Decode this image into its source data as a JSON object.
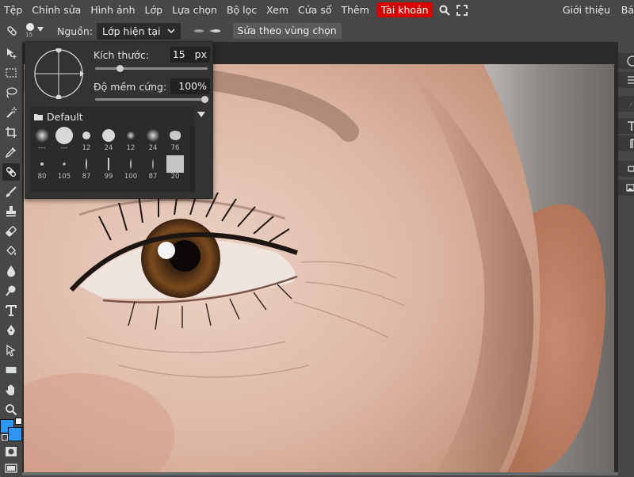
{
  "menu": {
    "items": [
      "Tệp",
      "Chỉnh sửa",
      "Hình ảnh",
      "Lớp",
      "Lựa chọn",
      "Bộ lọc",
      "Xem",
      "Cửa sổ",
      "Thêm"
    ],
    "account": "Tài khoản",
    "about": "Giới thiệu",
    "cut_item": "Bá"
  },
  "options": {
    "brush_size_small": "15",
    "source_label": "Nguồn:",
    "source_value": "Lớp hiện tại",
    "fix_button": "Sửa theo vùng chọn"
  },
  "brush_panel": {
    "size_label": "Kích thước:",
    "size_value": "15",
    "size_unit": "px",
    "size_fraction": 0.14,
    "hardness_label": "Độ mềm cứng:",
    "hardness_value": "100%",
    "hardness_fraction": 1.0,
    "preset_group": "Default",
    "presets_row1": [
      "---",
      "---",
      "12",
      "24",
      "12",
      "24",
      "76"
    ],
    "presets_row2": [
      "80",
      "105",
      "87",
      "99",
      "100",
      "87",
      "20"
    ]
  },
  "colors": {
    "accent": "#d60000",
    "foreground_color": "#2f96f3",
    "background_color": "#2f96f3"
  }
}
